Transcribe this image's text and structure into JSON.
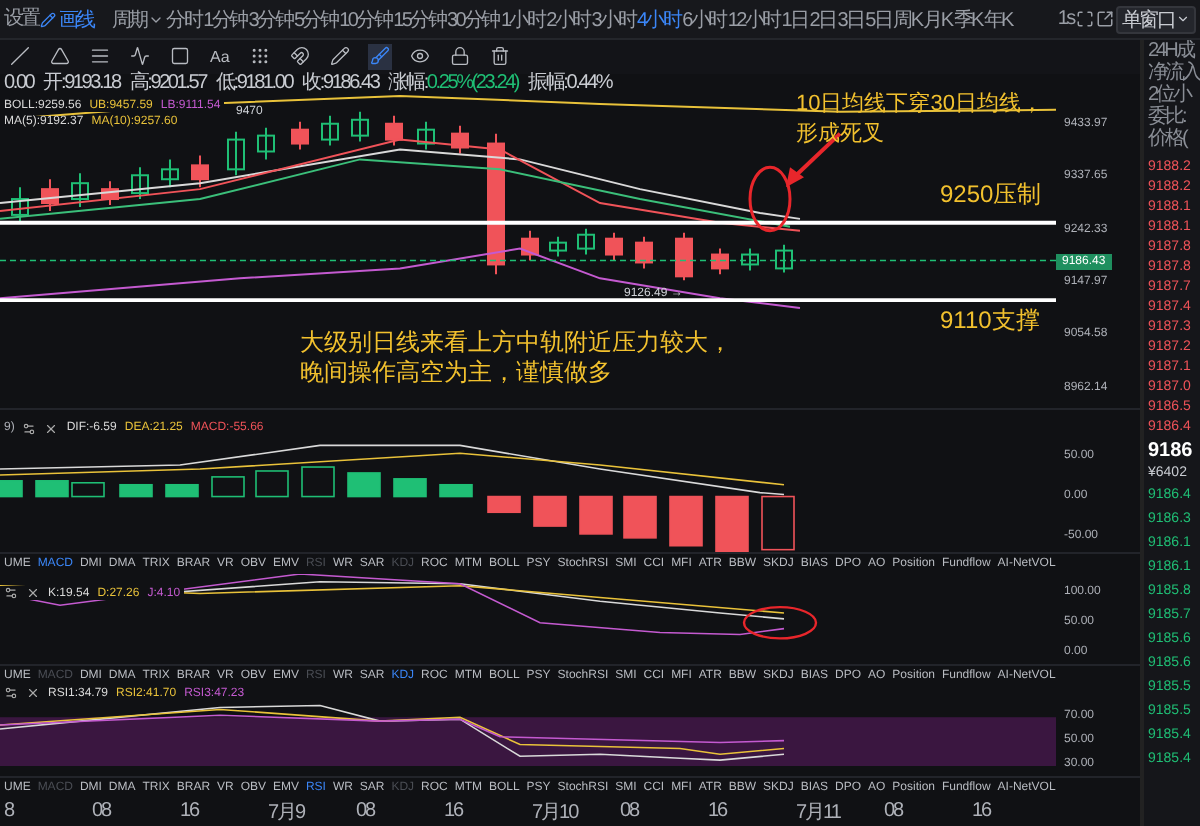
{
  "toolbar": {
    "settings": "设置",
    "draw_toggle": {
      "label": "画线",
      "on": true
    },
    "period_menu": "周期",
    "periods": [
      {
        "label": "分时",
        "selected": false
      },
      {
        "label": "1分钟",
        "selected": false
      },
      {
        "label": "3分钟",
        "selected": false
      },
      {
        "label": "5分钟",
        "selected": false
      },
      {
        "label": "10分钟",
        "selected": false
      },
      {
        "label": "15分钟",
        "selected": false
      },
      {
        "label": "30分钟",
        "selected": false
      },
      {
        "label": "1小时",
        "selected": false
      },
      {
        "label": "2小时",
        "selected": false
      },
      {
        "label": "3小时",
        "selected": false
      },
      {
        "label": "4小时",
        "selected": true
      },
      {
        "label": "6小时",
        "selected": false
      },
      {
        "label": "12小时",
        "selected": false
      },
      {
        "label": "1日",
        "selected": false
      },
      {
        "label": "2日",
        "selected": false
      },
      {
        "label": "3日",
        "selected": false
      },
      {
        "label": "5日",
        "selected": false
      },
      {
        "label": "周K",
        "selected": false
      },
      {
        "label": "月K",
        "selected": false
      },
      {
        "label": "季K",
        "selected": false
      },
      {
        "label": "年K",
        "selected": false
      }
    ],
    "refresh_rate": "1s",
    "layout_select": "单窗口"
  },
  "drawing_tools": [
    {
      "kind": "line",
      "selected": false
    },
    {
      "kind": "angle",
      "selected": false
    },
    {
      "kind": "hlines",
      "selected": false
    },
    {
      "kind": "wave",
      "selected": false
    },
    {
      "kind": "frame",
      "selected": false
    },
    {
      "kind": "text",
      "label": "Aa",
      "selected": false
    },
    {
      "kind": "dots",
      "selected": false
    },
    {
      "kind": "magnet",
      "selected": false
    },
    {
      "kind": "pencil",
      "selected": false
    },
    {
      "kind": "brush",
      "selected": true
    },
    {
      "kind": "eye",
      "selected": false
    },
    {
      "kind": "lock",
      "selected": false
    },
    {
      "kind": "trash",
      "selected": false
    }
  ],
  "quote": [
    {
      "value": "0.00",
      "kind": "plain"
    },
    {
      "label": "开:",
      "value": "9193.18",
      "kind": "plain"
    },
    {
      "label": "高:",
      "value": "9201.57",
      "kind": "plain"
    },
    {
      "label": "低:",
      "value": "9181.00",
      "kind": "plain"
    },
    {
      "label": "收:",
      "value": "9186.43",
      "kind": "plain"
    },
    {
      "label": "涨幅:",
      "value": "0.25%(23.24)",
      "kind": "change"
    },
    {
      "label": "振幅:",
      "value": "0.44%",
      "kind": "plain"
    }
  ],
  "main_chart": {
    "legend": [
      {
        "text": "BOLL:9259.56",
        "color": "#d9d9d9"
      },
      {
        "text": "UB:9457.59",
        "color": "#e9c23a"
      },
      {
        "text": "LB:9111.54",
        "color": "#c45ad0"
      }
    ],
    "legend_ma": [
      {
        "text": "MA(5):9192.37",
        "color": "#d9d9d9"
      },
      {
        "text": "MA(10):9257.60",
        "color": "#e9c23a"
      }
    ],
    "price_axis": [
      "9433.97",
      "9337.65",
      "9242.33",
      "9147.97",
      "9054.58",
      "8962.14"
    ],
    "current_price": "9186.43",
    "high_marker": "9470",
    "low_marker": "9126.49 →",
    "crossover_note": "10日均线下穿30日均线，形成死叉",
    "resistance_label": "9250压制",
    "support_label": "9110支撑",
    "outlook_note": "大级别日线来看上方中轨附近压力较大，晚间操作高空为主，谨慎做多"
  },
  "macd": {
    "params": "9)",
    "legend": [
      {
        "text": "DIF:-6.59",
        "color": "#d9d9d9"
      },
      {
        "text": "DEA:21.25",
        "color": "#e9c23a"
      },
      {
        "text": "MACD:-55.66",
        "color": "#f05359"
      }
    ],
    "axis": [
      "50.00",
      "0.00",
      "-50.00"
    ]
  },
  "macd_tabs": [
    {
      "label": "UME",
      "selected": false,
      "disabled": false
    },
    {
      "label": "MACD",
      "selected": true,
      "disabled": false
    },
    {
      "label": "DMI",
      "selected": false,
      "disabled": false
    },
    {
      "label": "DMA",
      "selected": false,
      "disabled": false
    },
    {
      "label": "TRIX",
      "selected": false,
      "disabled": false
    },
    {
      "label": "BRAR",
      "selected": false,
      "disabled": false
    },
    {
      "label": "VR",
      "selected": false,
      "disabled": false
    },
    {
      "label": "OBV",
      "selected": false,
      "disabled": false
    },
    {
      "label": "EMV",
      "selected": false,
      "disabled": false
    },
    {
      "label": "RSI",
      "selected": false,
      "disabled": true
    },
    {
      "label": "WR",
      "selected": false,
      "disabled": false
    },
    {
      "label": "SAR",
      "selected": false,
      "disabled": false
    },
    {
      "label": "KDJ",
      "selected": false,
      "disabled": true
    },
    {
      "label": "ROC",
      "selected": false,
      "disabled": false
    },
    {
      "label": "MTM",
      "selected": false,
      "disabled": false
    },
    {
      "label": "BOLL",
      "selected": false,
      "disabled": false
    },
    {
      "label": "PSY",
      "selected": false,
      "disabled": false
    },
    {
      "label": "StochRSI",
      "selected": false,
      "disabled": false
    },
    {
      "label": "SMI",
      "selected": false,
      "disabled": false
    },
    {
      "label": "CCI",
      "selected": false,
      "disabled": false
    },
    {
      "label": "MFI",
      "selected": false,
      "disabled": false
    },
    {
      "label": "ATR",
      "selected": false,
      "disabled": false
    },
    {
      "label": "BBW",
      "selected": false,
      "disabled": false
    },
    {
      "label": "SKDJ",
      "selected": false,
      "disabled": false
    },
    {
      "label": "BIAS",
      "selected": false,
      "disabled": false
    },
    {
      "label": "DPO",
      "selected": false,
      "disabled": false
    },
    {
      "label": "AO",
      "selected": false,
      "disabled": false
    },
    {
      "label": "Position",
      "selected": false,
      "disabled": false
    },
    {
      "label": "Fundflow",
      "selected": false,
      "disabled": false
    },
    {
      "label": "AI-NetVOL",
      "selected": false,
      "disabled": false
    }
  ],
  "kdj": {
    "legend": [
      {
        "text": "K:19.54",
        "color": "#d9d9d9"
      },
      {
        "text": "D:27.26",
        "color": "#e9c23a"
      },
      {
        "text": "J:4.10",
        "color": "#c45ad0"
      }
    ],
    "axis": [
      "100.00",
      "50.00",
      "0.00"
    ]
  },
  "kdj_tabs": [
    {
      "label": "UME",
      "selected": false,
      "disabled": false
    },
    {
      "label": "MACD",
      "selected": false,
      "disabled": true
    },
    {
      "label": "DMI",
      "selected": false,
      "disabled": false
    },
    {
      "label": "DMA",
      "selected": false,
      "disabled": false
    },
    {
      "label": "TRIX",
      "selected": false,
      "disabled": false
    },
    {
      "label": "BRAR",
      "selected": false,
      "disabled": false
    },
    {
      "label": "VR",
      "selected": false,
      "disabled": false
    },
    {
      "label": "OBV",
      "selected": false,
      "disabled": false
    },
    {
      "label": "EMV",
      "selected": false,
      "disabled": false
    },
    {
      "label": "RSI",
      "selected": false,
      "disabled": true
    },
    {
      "label": "WR",
      "selected": false,
      "disabled": false
    },
    {
      "label": "SAR",
      "selected": false,
      "disabled": false
    },
    {
      "label": "KDJ",
      "selected": true,
      "disabled": false
    },
    {
      "label": "ROC",
      "selected": false,
      "disabled": false
    },
    {
      "label": "MTM",
      "selected": false,
      "disabled": false
    },
    {
      "label": "BOLL",
      "selected": false,
      "disabled": false
    },
    {
      "label": "PSY",
      "selected": false,
      "disabled": false
    },
    {
      "label": "StochRSI",
      "selected": false,
      "disabled": false
    },
    {
      "label": "SMI",
      "selected": false,
      "disabled": false
    },
    {
      "label": "CCI",
      "selected": false,
      "disabled": false
    },
    {
      "label": "MFI",
      "selected": false,
      "disabled": false
    },
    {
      "label": "ATR",
      "selected": false,
      "disabled": false
    },
    {
      "label": "BBW",
      "selected": false,
      "disabled": false
    },
    {
      "label": "SKDJ",
      "selected": false,
      "disabled": false
    },
    {
      "label": "BIAS",
      "selected": false,
      "disabled": false
    },
    {
      "label": "DPO",
      "selected": false,
      "disabled": false
    },
    {
      "label": "AO",
      "selected": false,
      "disabled": false
    },
    {
      "label": "Position",
      "selected": false,
      "disabled": false
    },
    {
      "label": "Fundflow",
      "selected": false,
      "disabled": false
    },
    {
      "label": "AI-NetVOL",
      "selected": false,
      "disabled": false
    }
  ],
  "rsi": {
    "legend": [
      {
        "text": "RSI1:34.79",
        "color": "#d9d9d9"
      },
      {
        "text": "RSI2:41.70",
        "color": "#e9c23a"
      },
      {
        "text": "RSI3:47.23",
        "color": "#c45ad0"
      }
    ],
    "axis": [
      "70.00",
      "50.00",
      "30.00"
    ]
  },
  "rsi_tabs": [
    {
      "label": "UME",
      "selected": false,
      "disabled": false
    },
    {
      "label": "MACD",
      "selected": false,
      "disabled": true
    },
    {
      "label": "DMI",
      "selected": false,
      "disabled": false
    },
    {
      "label": "DMA",
      "selected": false,
      "disabled": false
    },
    {
      "label": "TRIX",
      "selected": false,
      "disabled": false
    },
    {
      "label": "BRAR",
      "selected": false,
      "disabled": false
    },
    {
      "label": "VR",
      "selected": false,
      "disabled": false
    },
    {
      "label": "OBV",
      "selected": false,
      "disabled": false
    },
    {
      "label": "EMV",
      "selected": false,
      "disabled": false
    },
    {
      "label": "RSI",
      "selected": true,
      "disabled": false
    },
    {
      "label": "WR",
      "selected": false,
      "disabled": false
    },
    {
      "label": "SAR",
      "selected": false,
      "disabled": false
    },
    {
      "label": "KDJ",
      "selected": false,
      "disabled": true
    },
    {
      "label": "ROC",
      "selected": false,
      "disabled": false
    },
    {
      "label": "MTM",
      "selected": false,
      "disabled": false
    },
    {
      "label": "BOLL",
      "selected": false,
      "disabled": false
    },
    {
      "label": "PSY",
      "selected": false,
      "disabled": false
    },
    {
      "label": "StochRSI",
      "selected": false,
      "disabled": false
    },
    {
      "label": "SMI",
      "selected": false,
      "disabled": false
    },
    {
      "label": "CCI",
      "selected": false,
      "disabled": false
    },
    {
      "label": "MFI",
      "selected": false,
      "disabled": false
    },
    {
      "label": "ATR",
      "selected": false,
      "disabled": false
    },
    {
      "label": "BBW",
      "selected": false,
      "disabled": false
    },
    {
      "label": "SKDJ",
      "selected": false,
      "disabled": false
    },
    {
      "label": "BIAS",
      "selected": false,
      "disabled": false
    },
    {
      "label": "DPO",
      "selected": false,
      "disabled": false
    },
    {
      "label": "AO",
      "selected": false,
      "disabled": false
    },
    {
      "label": "Position",
      "selected": false,
      "disabled": false
    },
    {
      "label": "Fundflow",
      "selected": false,
      "disabled": false
    },
    {
      "label": "AI-NetVOL",
      "selected": false,
      "disabled": false
    }
  ],
  "time_axis": [
    "8",
    "08",
    "16",
    "7月9",
    "08",
    "16",
    "7月10",
    "08",
    "16",
    "7月11",
    "08",
    "16"
  ],
  "order_panel": {
    "headers": [
      "24H成",
      "净流入",
      "2位小",
      "委比:",
      "价格("
    ],
    "asks": [
      "9188.2",
      "9188.2",
      "9188.1",
      "9188.1",
      "9187.8",
      "9187.8",
      "9187.7",
      "9187.4",
      "9187.3",
      "9187.2",
      "9187.1",
      "9187.0",
      "9186.5",
      "9186.4"
    ],
    "last_price": "9186",
    "last_price_cny": "¥6402",
    "bids": [
      "9186.4",
      "9186.3",
      "9186.1",
      "9186.1",
      "9185.8",
      "9185.7",
      "9185.6",
      "9185.6",
      "9185.5",
      "9185.5",
      "9185.4",
      "9185.4"
    ]
  }
}
